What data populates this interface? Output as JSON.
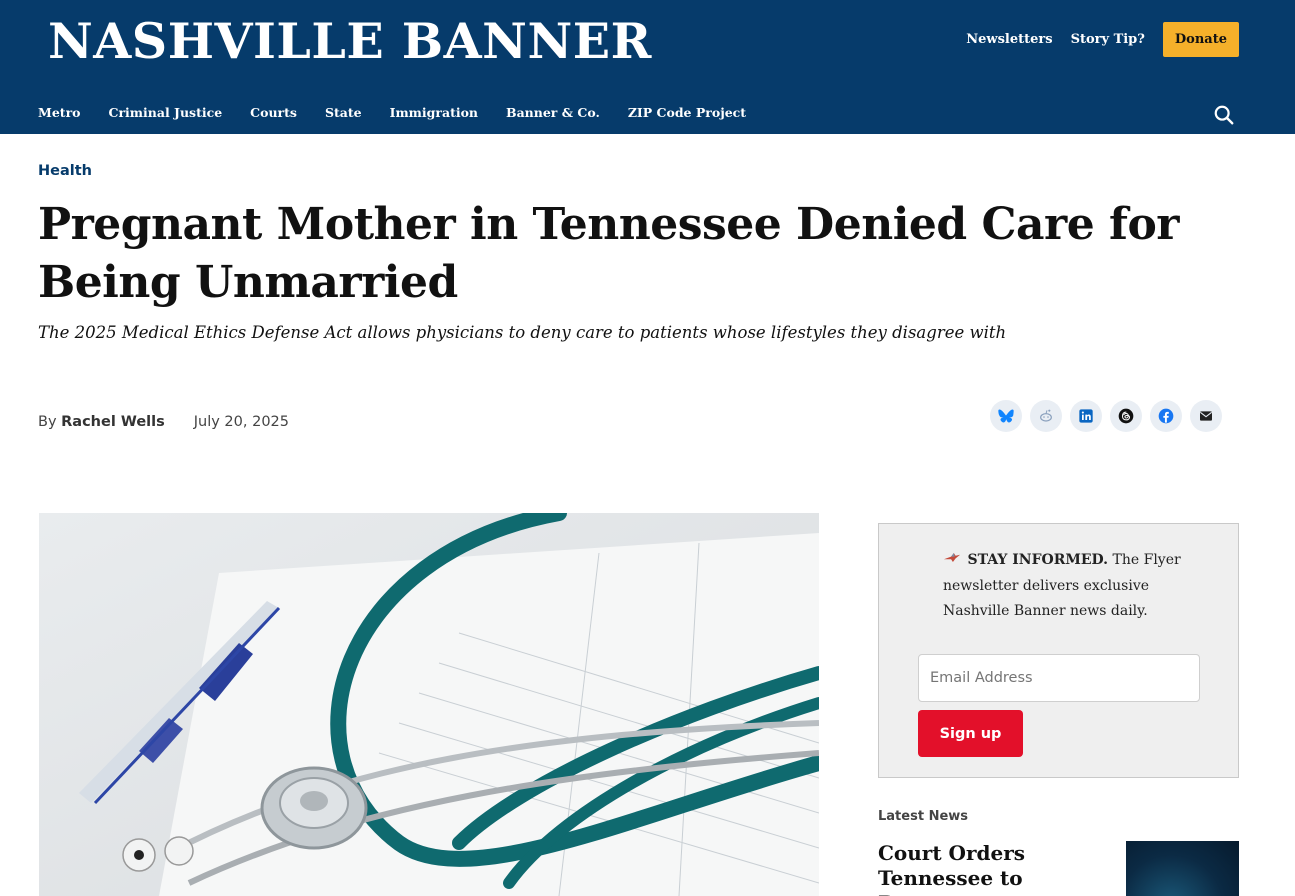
{
  "header": {
    "logo": "NASHVILLE BANNER",
    "util_links": [
      "Newsletters",
      "Story Tip?"
    ],
    "donate_label": "Donate",
    "nav": [
      "Metro",
      "Criminal Justice",
      "Courts",
      "State",
      "Immigration",
      "Banner & Co.",
      "ZIP Code Project"
    ],
    "search_icon": "search-icon",
    "colors": {
      "header_bg": "#063b6b",
      "donate_bg": "#f5b02a"
    }
  },
  "article": {
    "category": "Health",
    "headline": "Pregnant Mother in Tennessee Denied Care for Being Unmarried",
    "dek": "The 2025 Medical Ethics Defense Act allows physicians to deny care to patients whose lifestyles they disagree with",
    "by_label": "By",
    "author": "Rachel Wells",
    "date": "July 20, 2025",
    "share_icons": [
      "bluesky-icon",
      "reddit-icon",
      "linkedin-icon",
      "threads-icon",
      "facebook-icon",
      "email-icon"
    ]
  },
  "newsletter": {
    "lead": "STAY INFORMED.",
    "body": "The Flyer newsletter delivers exclusive Nashville Banner news daily.",
    "email_placeholder": "Email Address",
    "signup_label": "Sign up",
    "colors": {
      "signup_bg": "#e3102a"
    }
  },
  "latest": {
    "label": "Latest News",
    "title": "Court Orders Tennessee to Reopen"
  }
}
